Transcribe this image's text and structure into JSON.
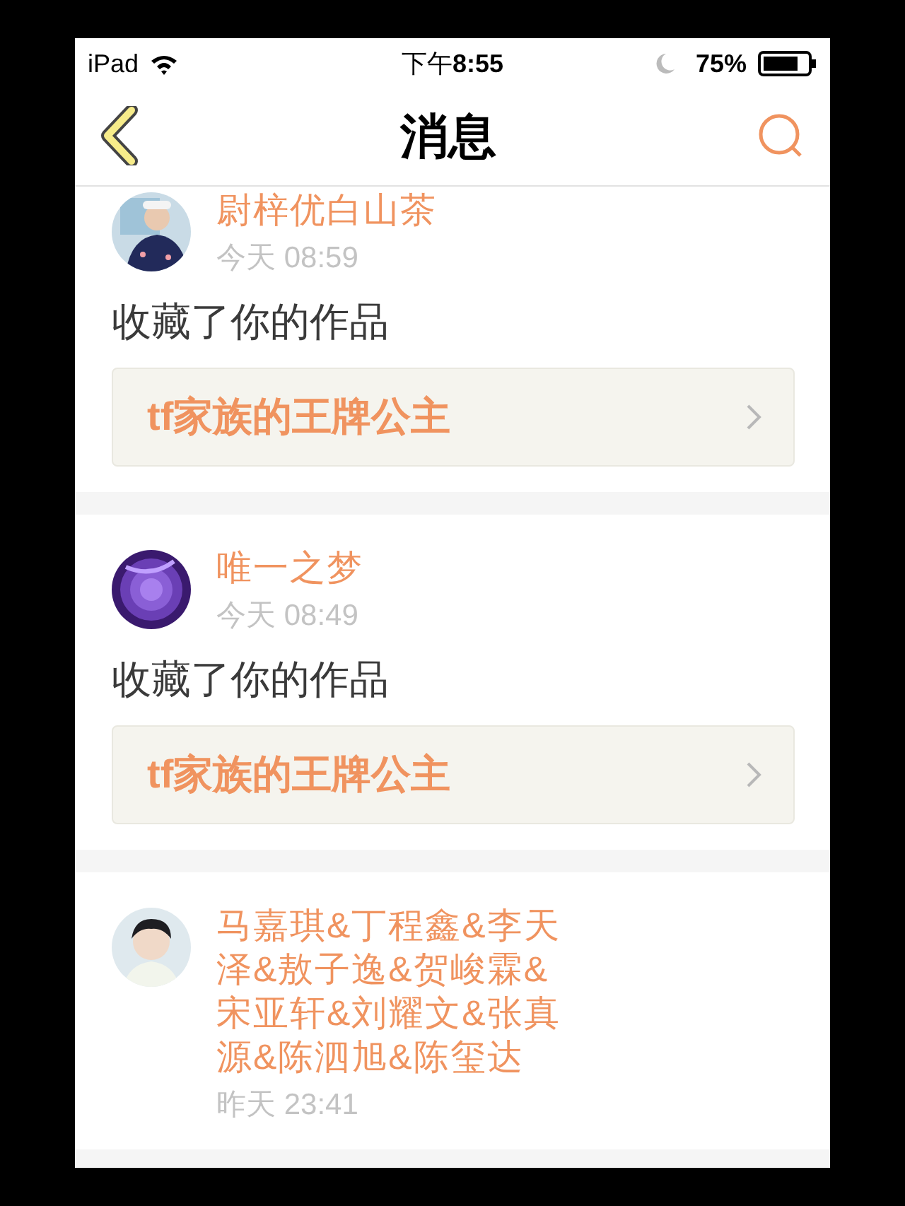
{
  "status_bar": {
    "carrier": "iPad",
    "time": "下午**8:55**",
    "battery": "75%"
  },
  "nav": {
    "title": "消息"
  },
  "messages": [
    {
      "name": "尉梓优白山茶",
      "time": "今天 08:59",
      "action": "收藏了你的作品",
      "work": "tf家族的王牌公主"
    },
    {
      "name": "唯一之梦",
      "time": "今天 08:49",
      "action": "收藏了你的作品",
      "work": "tf家族的王牌公主"
    },
    {
      "name": "马嘉琪&丁程鑫&李天泽&敖子逸&贺峻霖&宋亚轩&刘耀文&张真源&陈泗旭&陈玺达",
      "time": "昨天 23:41"
    }
  ]
}
